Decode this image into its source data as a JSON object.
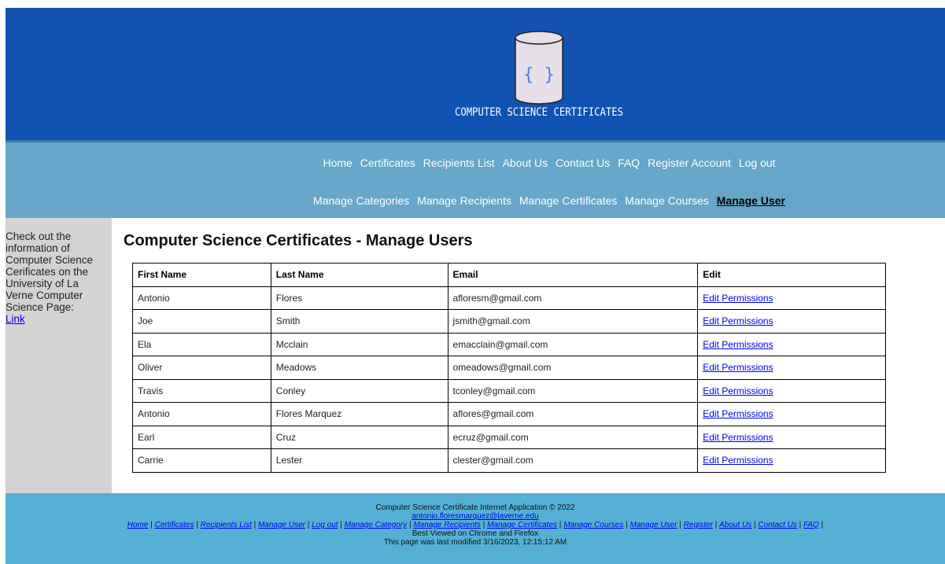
{
  "brand": {
    "logo_title": "COMPUTER SCIENCE CERTIFICATES",
    "logo_glyph": "{ }"
  },
  "nav": {
    "primary": [
      "Home",
      "Certificates",
      "Recipients List",
      "About Us",
      "Contact Us",
      "FAQ",
      "Register Account",
      "Log out"
    ],
    "admin": [
      "Manage Categories",
      "Manage Recipients",
      "Manage Certificates",
      "Manage Courses",
      "Manage User"
    ],
    "active": "Manage User"
  },
  "sidebar": {
    "text": "Check out the information of Computer Science Cerificates on the University of La Verne Computer Science Page:",
    "link_label": "Link"
  },
  "main": {
    "title": "Computer Science Certificates - Manage Users",
    "columns": [
      "First Name",
      "Last Name",
      "Email",
      "Edit"
    ],
    "edit_label": "Edit Permissions",
    "rows": [
      {
        "first": "Antonio",
        "last": "Flores",
        "email": "afloresm@gmail.com"
      },
      {
        "first": "Joe",
        "last": "Smith",
        "email": "jsmith@gmail.com"
      },
      {
        "first": "Ela",
        "last": "Mcclain",
        "email": "emacclain@gmail.com"
      },
      {
        "first": "Oliver",
        "last": "Meadows",
        "email": "omeadows@gmail.com"
      },
      {
        "first": "Travis",
        "last": "Conley",
        "email": "tconley@gmail.com"
      },
      {
        "first": "Antonio",
        "last": "Flores Marquez",
        "email": "aflores@gmail.com"
      },
      {
        "first": "Earl",
        "last": "Cruz",
        "email": "ecruz@gmail.com"
      },
      {
        "first": "Carrie",
        "last": "Lester",
        "email": "clester@gmail.com"
      }
    ]
  },
  "footer": {
    "copyright": "Computer Science Certificate Internet Application © 2022",
    "email": "antonio.floresmarquez@laverne.edu",
    "links": [
      "Home",
      "Certificates",
      "Recipients List",
      "Manage User",
      "Log out",
      "Manage Category",
      "Manage Recipients",
      "Manage Certificates",
      "Manage Courses",
      "Manage User",
      "Register",
      "About Us",
      "Contact Us",
      "FAQ"
    ],
    "best_viewed": "Best Viewed on Chrome and Firefox",
    "last_modified": "This page was last modified 3/16/2023, 12:15:12 AM"
  },
  "colors": {
    "header_bg": "#1152b3",
    "nav_bg": "#66a6c8",
    "sidebar_bg": "#d3d3d3",
    "footer_bg": "#55b0d4",
    "link": "#0000ee"
  },
  "icons": [
    "database-logo-icon"
  ]
}
